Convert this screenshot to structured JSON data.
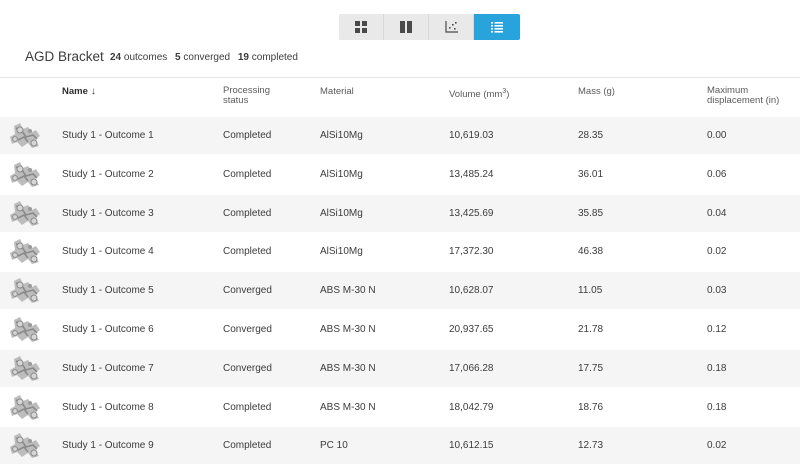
{
  "view_switcher": {
    "buttons": [
      {
        "icon": "grid-view-icon",
        "active": false
      },
      {
        "icon": "columns-view-icon",
        "active": false
      },
      {
        "icon": "scatter-plot-icon",
        "active": false
      },
      {
        "icon": "list-view-icon",
        "active": true
      }
    ],
    "accent_color": "#29a3dc"
  },
  "header": {
    "title": "AGD Bracket",
    "outcomes_count": "24",
    "outcomes_label": "outcomes",
    "converged_count": "5",
    "converged_label": "converged",
    "completed_count": "19",
    "completed_label": "completed"
  },
  "columns": {
    "name": "Name",
    "sort_arrow": "↓",
    "status_line1": "Processing",
    "status_line2": "status",
    "material": "Material",
    "volume_prefix": "Volume (mm",
    "volume_sup": "3",
    "volume_suffix": ")",
    "mass": "Mass (g)",
    "disp_line1": "Maximum",
    "disp_line2": "displacement (in)"
  },
  "rows": [
    {
      "name": "Study 1 - Outcome 1",
      "status": "Completed",
      "material": "AlSi10Mg",
      "volume": "10,619.03",
      "mass": "28.35",
      "displacement": "0.00"
    },
    {
      "name": "Study 1 - Outcome 2",
      "status": "Completed",
      "material": "AlSi10Mg",
      "volume": "13,485.24",
      "mass": "36.01",
      "displacement": "0.06"
    },
    {
      "name": "Study 1 - Outcome 3",
      "status": "Completed",
      "material": "AlSi10Mg",
      "volume": "13,425.69",
      "mass": "35.85",
      "displacement": "0.04"
    },
    {
      "name": "Study 1 - Outcome 4",
      "status": "Completed",
      "material": "AlSi10Mg",
      "volume": "17,372.30",
      "mass": "46.38",
      "displacement": "0.02"
    },
    {
      "name": "Study 1 - Outcome 5",
      "status": "Converged",
      "material": "ABS M-30 N",
      "volume": "10,628.07",
      "mass": "11.05",
      "displacement": "0.03"
    },
    {
      "name": "Study 1 - Outcome 6",
      "status": "Converged",
      "material": "ABS M-30 N",
      "volume": "20,937.65",
      "mass": "21.78",
      "displacement": "0.12"
    },
    {
      "name": "Study 1 - Outcome 7",
      "status": "Converged",
      "material": "ABS M-30 N",
      "volume": "17,066.28",
      "mass": "17.75",
      "displacement": "0.18"
    },
    {
      "name": "Study 1 - Outcome 8",
      "status": "Completed",
      "material": "ABS M-30 N",
      "volume": "18,042.79",
      "mass": "18.76",
      "displacement": "0.18"
    },
    {
      "name": "Study 1 - Outcome 9",
      "status": "Completed",
      "material": "PC 10",
      "volume": "10,612.15",
      "mass": "12.73",
      "displacement": "0.02"
    }
  ]
}
